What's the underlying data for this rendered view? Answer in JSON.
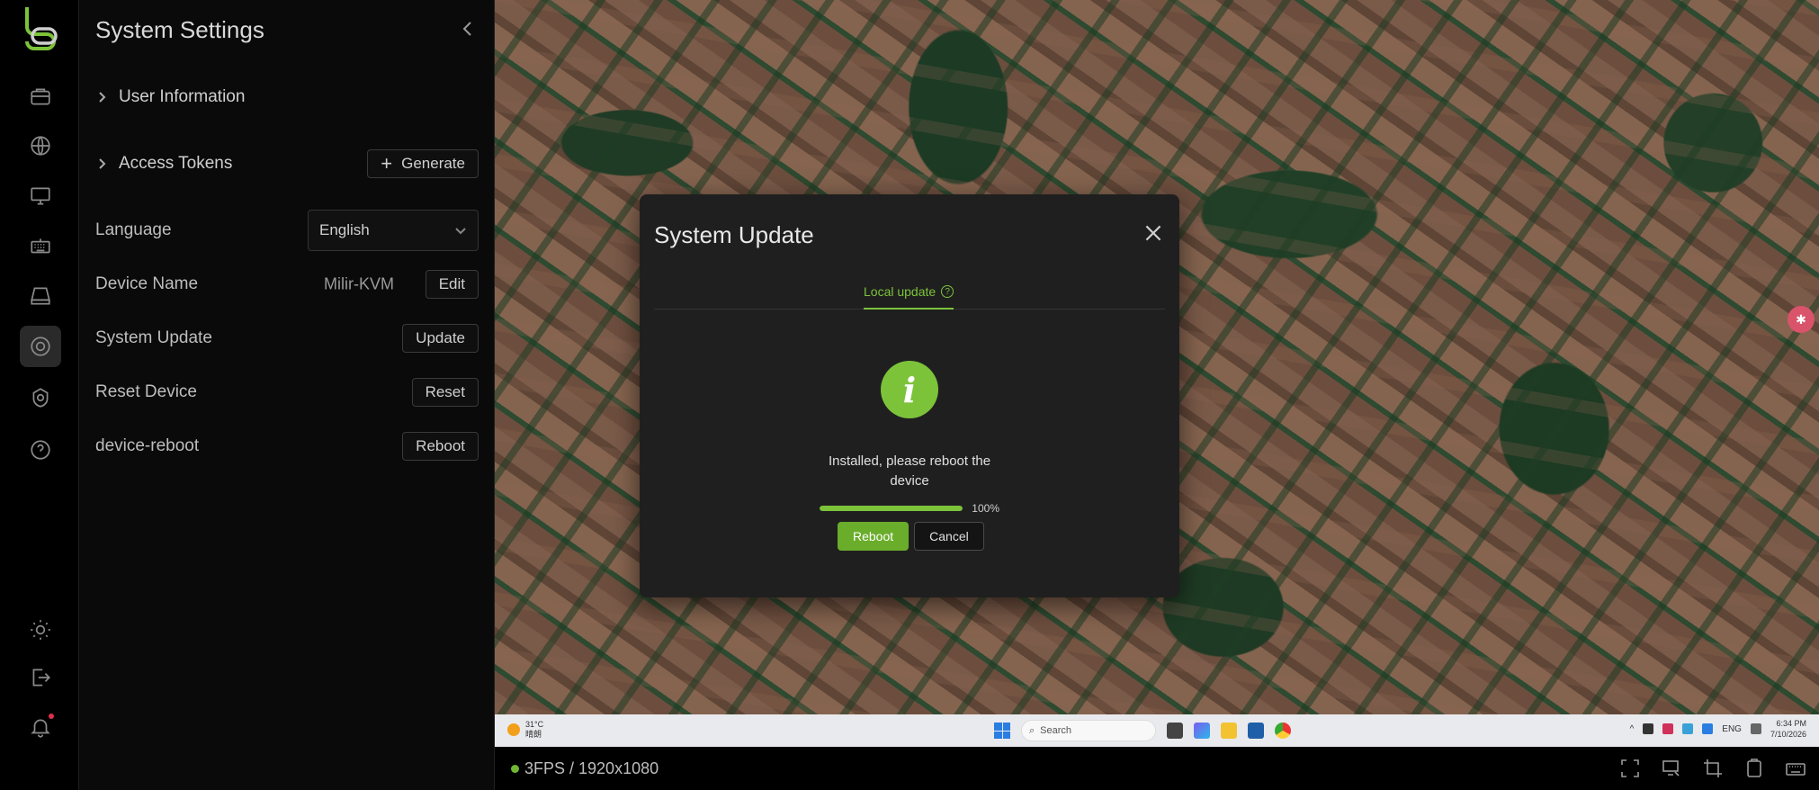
{
  "sidebar": {
    "items": [
      {
        "name": "briefcase-icon"
      },
      {
        "name": "globe-icon"
      },
      {
        "name": "monitor-icon"
      },
      {
        "name": "keyboard-icon"
      },
      {
        "name": "storage-icon"
      },
      {
        "name": "settings-icon",
        "active": true
      },
      {
        "name": "device-settings-icon"
      },
      {
        "name": "help-icon"
      }
    ],
    "bottom": [
      {
        "name": "theme-icon"
      },
      {
        "name": "logout-icon"
      },
      {
        "name": "notification-icon"
      }
    ]
  },
  "settings": {
    "title": "System Settings",
    "user_information": "User Information",
    "access_tokens": "Access Tokens",
    "generate_label": "Generate",
    "language_label": "Language",
    "language_value": "English",
    "device_name_label": "Device Name",
    "device_name_value": "Milir-KVM",
    "edit_label": "Edit",
    "system_update_label": "System Update",
    "update_label": "Update",
    "reset_device_label": "Reset Device",
    "reset_label": "Reset",
    "device_reboot_label": "device-reboot",
    "reboot_label": "Reboot"
  },
  "modal": {
    "title": "System Update",
    "tab_label": "Local update",
    "tab_help": "?",
    "info_glyph": "i",
    "message": "Installed, please reboot the device",
    "progress_percent": 100,
    "progress_label": "100%",
    "reboot_button": "Reboot",
    "cancel_button": "Cancel"
  },
  "taskbar": {
    "weather_temp": "31°C",
    "weather_desc": "晴朗",
    "search_placeholder": "Search",
    "lang": "ENG",
    "time": "6:34 PM",
    "date": "7/10/2026"
  },
  "status": {
    "text": "3FPS / 1920x1080",
    "accent": "#6fb733"
  },
  "colors": {
    "accent": "#7cc33a",
    "background": "#000000",
    "panel": "#0a0a0a",
    "modal": "#1f1f1f"
  }
}
